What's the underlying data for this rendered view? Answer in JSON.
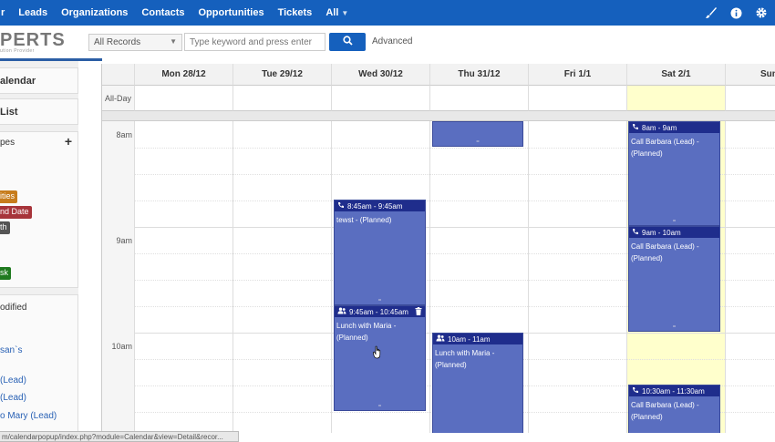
{
  "nav": {
    "items": [
      "r",
      "Leads",
      "Organizations",
      "Contacts",
      "Opportunities",
      "Tickets",
      "All"
    ],
    "icons": [
      "brush-icon",
      "info-icon",
      "gear-icon"
    ]
  },
  "brand": {
    "logo_text": "PERTS",
    "tagline": "ution Provider"
  },
  "search": {
    "record_filter": "All Records",
    "keyword_placeholder": "Type keyword and press enter",
    "advanced_label": "Advanced"
  },
  "sidebar": {
    "calendar_label": "alendar",
    "list_label": "List",
    "types_label": "pes",
    "tags": [
      {
        "label": "ities",
        "color": "#c77c1c"
      },
      {
        "label": "nd Date",
        "color": "#a7343a"
      },
      {
        "label": "th",
        "color": "#555555"
      },
      {
        "label": "sk",
        "color": "#1f7a1f"
      }
    ],
    "modified_label": "odified",
    "links": [
      "san`s",
      "(Lead)",
      "(Lead)",
      "o Mary (Lead)"
    ]
  },
  "calendar": {
    "allday_label": "All-Day",
    "days": [
      "Mon 28/12",
      "Tue 29/12",
      "Wed 30/12",
      "Thu 31/12",
      "Fri 1/1",
      "Sat 2/1",
      "Sun"
    ],
    "today_index": 5,
    "today_color": "#ffffcc",
    "times": [
      "8am",
      "9am",
      "10am"
    ],
    "events": [
      {
        "time": "",
        "title": "",
        "icon": "phone-icon"
      },
      {
        "time": "8am - 9am",
        "title": "Call Barbara (Lead) - (Planned)",
        "icon": "phone-icon"
      },
      {
        "time": "8:45am - 9:45am",
        "title": "tewst - (Planned)",
        "icon": "phone-icon"
      },
      {
        "time": "9am - 10am",
        "title": "Call Barbara (Lead) - (Planned)",
        "icon": "phone-icon"
      },
      {
        "time": "9:45am - 10:45am",
        "title": "Lunch with Maria - (Planned)",
        "icon": "people-icon"
      },
      {
        "time": "10am - 11am",
        "title": "Lunch with Maria - (Planned)",
        "icon": "people-icon"
      },
      {
        "time": "10:30am - 11:30am",
        "title": "Call Barbara (Lead) - (Planned)",
        "icon": "phone-icon"
      }
    ]
  },
  "status_url": "m/calendarpopup/index.php?module=Calendar&view=Detail&recor..."
}
